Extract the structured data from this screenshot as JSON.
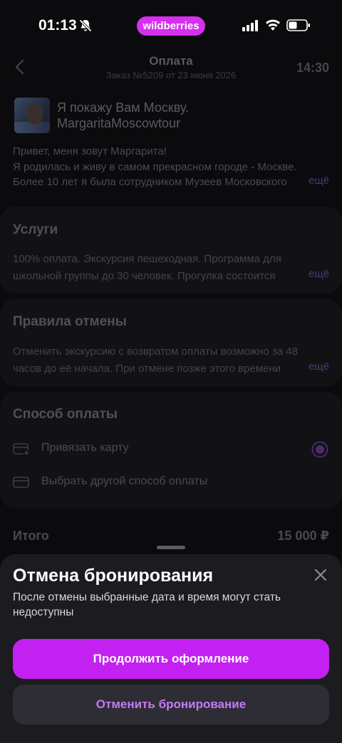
{
  "status_bar": {
    "time": "01:13",
    "brand": "wildberries"
  },
  "header": {
    "title": "Оплата",
    "subtitle": "Заказ №5209 от 23 июня 2026",
    "time": "14:30"
  },
  "tour": {
    "name": "Я покажу Вам Москву.",
    "handle": "MargaritaMoscowtour",
    "about_lines": [
      "Привет, меня зовут Маргарита!",
      "Я родилась и живу в самом прекрасном городе - Москве.",
      "Более 10 лет я была сотрудником Музеев Московского"
    ],
    "more": "ещё"
  },
  "services": {
    "title": "Услуги",
    "lines": [
      "100% оплата. Экскурсия пешеходная. Программа для",
      "школьной группы до 30 человек. Прогулка состоится"
    ],
    "more": "ещё"
  },
  "cancellation_rules": {
    "title": "Правила отмены",
    "lines": [
      "Отменить экскурсию с возвратом оплаты возможно за 48",
      "часов до её начала. При отмене позже этого времени"
    ],
    "more": "ещё"
  },
  "payment": {
    "title": "Способ оплаты",
    "options": [
      {
        "label": "Привязать карту",
        "icon": "card-plus-icon",
        "selected": true
      },
      {
        "label": "Выбрать другой способ оплаты",
        "icon": "card-icon",
        "selected": false
      }
    ]
  },
  "total": {
    "label": "Итого",
    "value": "15 000 ₽"
  },
  "sheet": {
    "title": "Отмена бронирования",
    "text": "После отмены выбранные дата и время могут стать недоступны",
    "primary_label": "Продолжить оформление",
    "secondary_label": "Отменить бронирование"
  },
  "colors": {
    "accent": "#c321f2",
    "brand": "#d62ff0",
    "secondary_text": "#c57af5"
  }
}
